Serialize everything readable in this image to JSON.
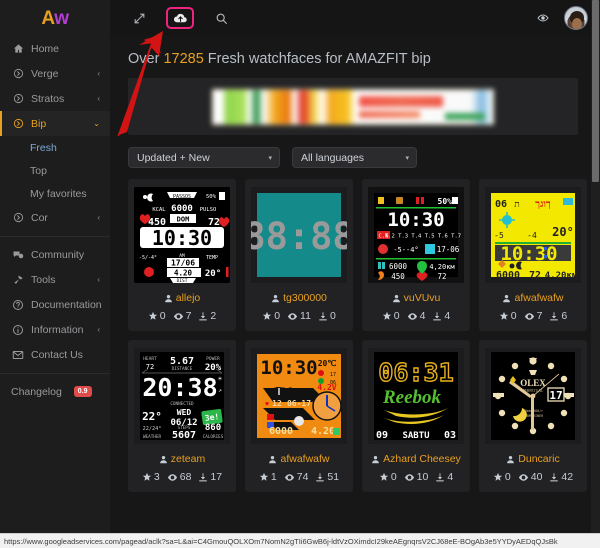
{
  "brand": {
    "logo_a": "A",
    "logo_w": "w"
  },
  "topbar": {
    "icons": [
      {
        "name": "expand-icon",
        "label": "Expand"
      },
      {
        "name": "cloud-upload-icon",
        "label": "Upload",
        "highlighted": true
      },
      {
        "name": "search-icon",
        "label": "Search"
      }
    ],
    "right_icons": [
      {
        "name": "eye-icon",
        "label": "Views"
      },
      {
        "name": "avatar",
        "label": "User avatar"
      }
    ]
  },
  "sidebar": {
    "items": [
      {
        "label": "Home",
        "icon": "home-icon",
        "caret": "",
        "active": false
      },
      {
        "label": "Verge",
        "icon": "circle-arrow-icon",
        "caret": "‹",
        "active": false
      },
      {
        "label": "Stratos",
        "icon": "circle-arrow-icon",
        "caret": "‹",
        "active": false
      },
      {
        "label": "Bip",
        "icon": "circle-arrow-icon",
        "caret": "⌄",
        "active": true
      }
    ],
    "sub_items": [
      {
        "label": "Fresh",
        "selected": true
      },
      {
        "label": "Top",
        "selected": false
      },
      {
        "label": "My favorites",
        "selected": false
      }
    ],
    "items2": [
      {
        "label": "Cor",
        "icon": "circle-arrow-icon",
        "caret": "‹"
      }
    ],
    "items3": [
      {
        "label": "Community",
        "icon": "community-icon",
        "caret": ""
      },
      {
        "label": "Tools",
        "icon": "hammer-icon",
        "caret": "‹"
      },
      {
        "label": "Documentation",
        "icon": "question-circle-icon",
        "caret": ""
      },
      {
        "label": "Information",
        "icon": "info-circle-icon",
        "caret": "‹"
      },
      {
        "label": "Contact Us",
        "icon": "envelope-icon",
        "caret": ""
      }
    ],
    "changelog": {
      "label": "Changelog",
      "badge": "0.9"
    }
  },
  "page": {
    "title_pre": "Over ",
    "title_count": "17285",
    "title_post": " Fresh watchfaces for AMAZFIT bip",
    "ad_alt": "advertisement-banner"
  },
  "filters": {
    "sort": {
      "value": "Updated + New",
      "arrow": "▾"
    },
    "language": {
      "value": "All languages",
      "arrow": "▾"
    }
  },
  "cards": [
    {
      "author": "allejo",
      "stars": "0",
      "views": "7",
      "downloads": "2",
      "preview": "black-casio-digital",
      "time": "10:30",
      "fields": {
        "kcal": "450",
        "steps": "6000",
        "pulse": "72",
        "date": "17/06",
        "dist": "4.20",
        "temp": "20°",
        "batt": "50",
        "top_label": "PASSOS",
        "kcal_label": "KCAL",
        "pulse_label": "PULSO",
        "day": "DOM",
        "ampm": "AM",
        "dist_label": "DIST",
        "temp_label": "TEMP",
        "weather": "-5/-4°"
      }
    },
    {
      "author": "tg300000",
      "stars": "0",
      "views": "11",
      "downloads": "0",
      "preview": "teal-seven-segment",
      "time": "88:88"
    },
    {
      "author": "vuVUvu",
      "stars": "0",
      "views": "4",
      "downloads": "4",
      "preview": "black-green-line",
      "time": "10:30",
      "fields": {
        "batt": "50%",
        "steps": "6000",
        "dist": "4,20км",
        "kcal": "450",
        "pulse": "72",
        "weather": "-5--4°",
        "alt": "17-06",
        "cn": "C.N",
        "row": "T.2 T.3 T.4 T.5 T.6 T.7"
      }
    },
    {
      "author": "afwafwafw",
      "stars": "0",
      "views": "7",
      "downloads": "6",
      "preview": "yellow-digital",
      "time": "10:30",
      "fields": {
        "day": "06",
        "temp": "20°",
        "steps": "6000",
        "pulse": "72",
        "dist": "4.20км",
        "weather1": "-5",
        "weather2": "-4"
      }
    },
    {
      "author": "zeteam",
      "stars": "3",
      "views": "68",
      "downloads": "17",
      "preview": "black-bold-digital",
      "time": "20:38",
      "fields": {
        "heart_label": "HEART",
        "heart": "72",
        "dist": "5.67",
        "dist_label": "DISTANCE",
        "power_label": "POWER",
        "power": "20%",
        "connected": "CONNECTED",
        "temp": "22°",
        "weather_label": "WEATHER",
        "range": "22/24°",
        "date_day": "WED",
        "date": "06/12",
        "steps_label": "STEPS",
        "steps": "5607",
        "cal_label": "CALORIES",
        "cal": "860",
        "logo": "3e!"
      }
    },
    {
      "author": "afwafwafw",
      "stars": "1",
      "views": "74",
      "downloads": "51",
      "preview": "orange-tech",
      "time": "10:30",
      "fields": {
        "temp": "20℃",
        "pulse": "12",
        "date": "06-17",
        "steps": "6000",
        "dist": "4.20"
      }
    },
    {
      "author": "Azhard Cheesey",
      "stars": "0",
      "views": "10",
      "downloads": "4",
      "preview": "reebok-brand",
      "time": "06:31",
      "fields": {
        "brand": "Reebok",
        "left": "09",
        "day": "SABTU",
        "right": "03"
      }
    },
    {
      "author": "Duncaric",
      "stars": "0",
      "views": "40",
      "downloads": "42",
      "preview": "rolex-analog",
      "fields": {
        "brand": "OLEX",
        "sub": "PERPETUAL",
        "date": "17",
        "detail": "60mm 300/r SUBMARINER"
      }
    }
  ],
  "statusbar": {
    "url": "https://www.googleadservices.com/pagead/aclk?sa=L&ai=C4GmouQOLXOm7NomN2gTIi6GwB6j-ldtVzOXimdcI29keAEgnqrsV2CJ68eE-BOgAb3e5YYDyAEDqQJsBk"
  },
  "annotation": {
    "arrow_color": "#d31414",
    "highlight_color": "#f0247e"
  },
  "colors": {
    "accent": "#e8a020",
    "sidebar_bg": "#1d1d1d",
    "main_bg": "#171717",
    "card_bg": "#222224"
  }
}
